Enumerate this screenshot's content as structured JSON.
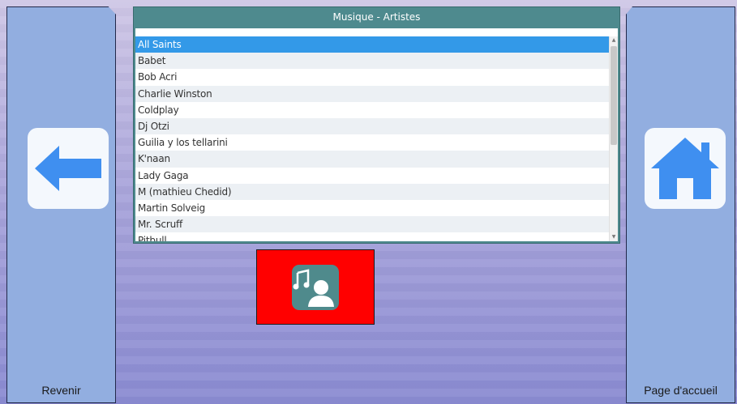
{
  "nav": {
    "back_label": "Revenir",
    "home_label": "Page d'accueil"
  },
  "panel": {
    "title": "Musique - Artistes",
    "artists": [
      "All Saints",
      "Babet",
      "Bob Acri",
      "Charlie Winston",
      "Coldplay",
      "Dj Otzi",
      "Guilia y los tellarini",
      "K'naan",
      "Lady Gaga",
      "M (mathieu Chedid)",
      "Martin Solveig",
      "Mr. Scruff",
      "Pitbull"
    ],
    "selected": "All Saints"
  },
  "colors": {
    "side": "#92aee0",
    "panel_header": "#4e8a8e",
    "selected_row": "#3399e8",
    "action_button": "#ff0000",
    "icon_blue": "#3f8ff0"
  },
  "icons": {
    "back": "arrow-left-icon",
    "home": "home-icon",
    "action": "music-artist-icon"
  }
}
